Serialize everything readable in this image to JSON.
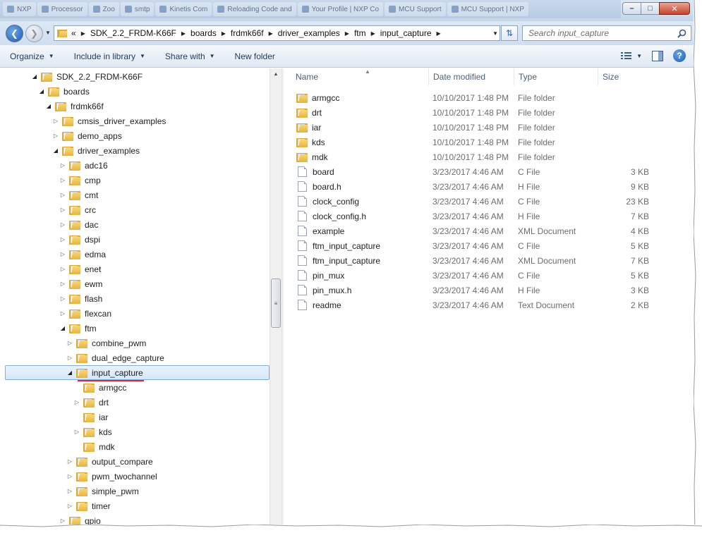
{
  "background_tabs": [
    "NXP",
    "Processor",
    "Zoo",
    "smtp",
    "Kinetis Com",
    "Reloading Code and",
    "Your Profile | NXP Co",
    "MCU Support",
    "MCU Support | NXP"
  ],
  "address": {
    "overflow": "«",
    "crumbs": [
      "SDK_2.2_FRDM-K66F",
      "boards",
      "frdmk66f",
      "driver_examples",
      "ftm",
      "input_capture"
    ]
  },
  "search": {
    "placeholder": "Search input_capture"
  },
  "commands": {
    "organize": "Organize",
    "include": "Include in library",
    "share": "Share with",
    "new_folder": "New folder"
  },
  "tree": [
    {
      "label": "SDK_2.2_FRDM-K66F",
      "level": 0,
      "exp": "open"
    },
    {
      "label": "boards",
      "level": 1,
      "exp": "open"
    },
    {
      "label": "frdmk66f",
      "level": 2,
      "exp": "open"
    },
    {
      "label": "cmsis_driver_examples",
      "level": 3,
      "exp": "closed"
    },
    {
      "label": "demo_apps",
      "level": 3,
      "exp": "closed"
    },
    {
      "label": "driver_examples",
      "level": 3,
      "exp": "open"
    },
    {
      "label": "adc16",
      "level": 4,
      "exp": "closed"
    },
    {
      "label": "cmp",
      "level": 4,
      "exp": "closed"
    },
    {
      "label": "cmt",
      "level": 4,
      "exp": "closed"
    },
    {
      "label": "crc",
      "level": 4,
      "exp": "closed"
    },
    {
      "label": "dac",
      "level": 4,
      "exp": "closed"
    },
    {
      "label": "dspi",
      "level": 4,
      "exp": "closed"
    },
    {
      "label": "edma",
      "level": 4,
      "exp": "closed"
    },
    {
      "label": "enet",
      "level": 4,
      "exp": "closed"
    },
    {
      "label": "ewm",
      "level": 4,
      "exp": "closed"
    },
    {
      "label": "flash",
      "level": 4,
      "exp": "closed"
    },
    {
      "label": "flexcan",
      "level": 4,
      "exp": "closed"
    },
    {
      "label": "ftm",
      "level": 4,
      "exp": "open"
    },
    {
      "label": "combine_pwm",
      "level": 5,
      "exp": "closed"
    },
    {
      "label": "dual_edge_capture",
      "level": 5,
      "exp": "closed"
    },
    {
      "label": "input_capture",
      "level": 5,
      "exp": "open",
      "selected": true
    },
    {
      "label": "armgcc",
      "level": 6,
      "exp": "none"
    },
    {
      "label": "drt",
      "level": 6,
      "exp": "closed"
    },
    {
      "label": "iar",
      "level": 6,
      "exp": "none"
    },
    {
      "label": "kds",
      "level": 6,
      "exp": "closed"
    },
    {
      "label": "mdk",
      "level": 6,
      "exp": "none"
    },
    {
      "label": "output_compare",
      "level": 5,
      "exp": "closed"
    },
    {
      "label": "pwm_twochannel",
      "level": 5,
      "exp": "closed"
    },
    {
      "label": "simple_pwm",
      "level": 5,
      "exp": "closed"
    },
    {
      "label": "timer",
      "level": 5,
      "exp": "closed"
    },
    {
      "label": "gpio",
      "level": 4,
      "exp": "closed"
    }
  ],
  "columns": {
    "name": "Name",
    "date": "Date modified",
    "type": "Type",
    "size": "Size"
  },
  "files": [
    {
      "name": "armgcc",
      "date": "10/10/2017 1:48 PM",
      "type": "File folder",
      "size": "",
      "kind": "folder"
    },
    {
      "name": "drt",
      "date": "10/10/2017 1:48 PM",
      "type": "File folder",
      "size": "",
      "kind": "folder"
    },
    {
      "name": "iar",
      "date": "10/10/2017 1:48 PM",
      "type": "File folder",
      "size": "",
      "kind": "folder"
    },
    {
      "name": "kds",
      "date": "10/10/2017 1:48 PM",
      "type": "File folder",
      "size": "",
      "kind": "folder"
    },
    {
      "name": "mdk",
      "date": "10/10/2017 1:48 PM",
      "type": "File folder",
      "size": "",
      "kind": "folder"
    },
    {
      "name": "board",
      "date": "3/23/2017 4:46 AM",
      "type": "C File",
      "size": "3 KB",
      "kind": "file"
    },
    {
      "name": "board.h",
      "date": "3/23/2017 4:46 AM",
      "type": "H File",
      "size": "9 KB",
      "kind": "file"
    },
    {
      "name": "clock_config",
      "date": "3/23/2017 4:46 AM",
      "type": "C File",
      "size": "23 KB",
      "kind": "file"
    },
    {
      "name": "clock_config.h",
      "date": "3/23/2017 4:46 AM",
      "type": "H File",
      "size": "7 KB",
      "kind": "file"
    },
    {
      "name": "example",
      "date": "3/23/2017 4:46 AM",
      "type": "XML Document",
      "size": "4 KB",
      "kind": "file"
    },
    {
      "name": "ftm_input_capture",
      "date": "3/23/2017 4:46 AM",
      "type": "C File",
      "size": "5 KB",
      "kind": "file"
    },
    {
      "name": "ftm_input_capture",
      "date": "3/23/2017 4:46 AM",
      "type": "XML Document",
      "size": "7 KB",
      "kind": "file"
    },
    {
      "name": "pin_mux",
      "date": "3/23/2017 4:46 AM",
      "type": "C File",
      "size": "5 KB",
      "kind": "file"
    },
    {
      "name": "pin_mux.h",
      "date": "3/23/2017 4:46 AM",
      "type": "H File",
      "size": "3 KB",
      "kind": "file"
    },
    {
      "name": "readme",
      "date": "3/23/2017 4:46 AM",
      "type": "Text Document",
      "size": "2 KB",
      "kind": "file"
    }
  ],
  "colors": {
    "selection": "#d4e7fb",
    "selection_border": "#84acdd",
    "annotation_red": "#e0262f",
    "folder": "#e7b441"
  }
}
